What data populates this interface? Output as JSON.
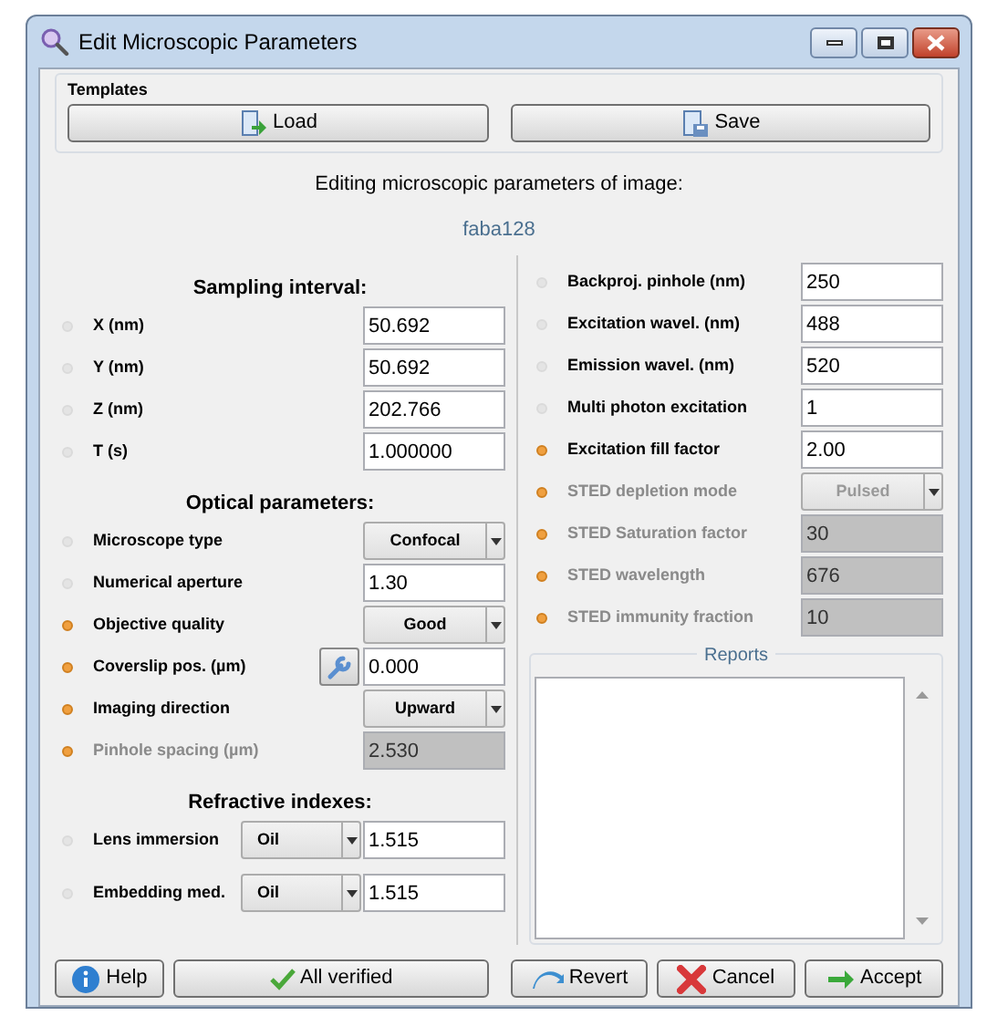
{
  "window": {
    "title": "Edit Microscopic Parameters"
  },
  "templates": {
    "title": "Templates",
    "buttons": [
      {
        "kind": "load",
        "label": "Load"
      },
      {
        "kind": "save",
        "label": "Save"
      }
    ]
  },
  "heading": "Editing microscopic parameters of image:",
  "image_name": "faba128",
  "left_sections": [
    {
      "title": "Sampling interval:",
      "rows": [
        {
          "label": "X (nm)",
          "verified": true,
          "disabled": false,
          "kind": "text",
          "value": "50.692"
        },
        {
          "label": "Y (nm)",
          "verified": true,
          "disabled": false,
          "kind": "text",
          "value": "50.692"
        },
        {
          "label": "Z (nm)",
          "verified": true,
          "disabled": false,
          "kind": "text",
          "value": "202.766"
        },
        {
          "label": "T (s)",
          "verified": true,
          "disabled": false,
          "kind": "text",
          "value": "1.000000"
        }
      ]
    },
    {
      "title": "Optical parameters:",
      "rows": [
        {
          "label": "Microscope type",
          "verified": true,
          "disabled": false,
          "kind": "combo",
          "value": "Confocal"
        },
        {
          "label": "Numerical aperture",
          "verified": true,
          "disabled": false,
          "kind": "text",
          "value": "1.30"
        },
        {
          "label": "Objective quality",
          "verified": false,
          "disabled": false,
          "kind": "combo",
          "value": "Good"
        },
        {
          "label": "Coverslip pos. (µm)",
          "verified": false,
          "disabled": false,
          "kind": "tool_text",
          "value": "0.000"
        },
        {
          "label": "Imaging direction",
          "verified": false,
          "disabled": false,
          "kind": "combo",
          "value": "Upward"
        },
        {
          "label": "Pinhole spacing (µm)",
          "verified": false,
          "disabled": true,
          "kind": "text",
          "value": "2.530"
        }
      ]
    },
    {
      "title": "Refractive indexes:",
      "rows": [
        {
          "label": "Lens immersion",
          "verified": true,
          "disabled": false,
          "kind": "medium",
          "medium": "Oil",
          "value": "1.515"
        },
        {
          "label": "Embedding med.",
          "verified": true,
          "disabled": false,
          "kind": "medium",
          "medium": "Oil",
          "value": "1.515"
        }
      ]
    }
  ],
  "right_rows": [
    {
      "label": "Backproj. pinhole (nm)",
      "verified": true,
      "disabled": false,
      "kind": "text",
      "value": "250"
    },
    {
      "label": "Excitation wavel. (nm)",
      "verified": true,
      "disabled": false,
      "kind": "text",
      "value": "488"
    },
    {
      "label": "Emission wavel. (nm)",
      "verified": true,
      "disabled": false,
      "kind": "text",
      "value": "520"
    },
    {
      "label": "Multi photon excitation",
      "verified": true,
      "disabled": false,
      "kind": "text",
      "value": "1"
    },
    {
      "label": "Excitation fill factor",
      "verified": false,
      "disabled": false,
      "kind": "text",
      "value": "2.00"
    },
    {
      "label": "STED depletion mode",
      "verified": false,
      "disabled": true,
      "kind": "combo",
      "value": "Pulsed"
    },
    {
      "label": "STED Saturation factor",
      "verified": false,
      "disabled": true,
      "kind": "text",
      "value": "30"
    },
    {
      "label": "STED wavelength",
      "verified": false,
      "disabled": true,
      "kind": "text",
      "value": "676"
    },
    {
      "label": "STED immunity fraction",
      "verified": false,
      "disabled": true,
      "kind": "text",
      "value": "10"
    }
  ],
  "reports": {
    "title": "Reports"
  },
  "footer_buttons": [
    {
      "kind": "help",
      "label": "Help"
    },
    {
      "kind": "verified",
      "label": "All verified"
    },
    {
      "kind": "revert",
      "label": "Revert"
    },
    {
      "kind": "cancel",
      "label": "Cancel"
    },
    {
      "kind": "accept",
      "label": "Accept"
    }
  ]
}
